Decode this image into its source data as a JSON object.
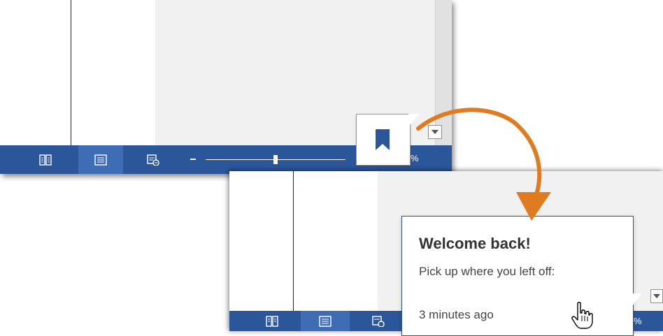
{
  "top_statusbar": {
    "view_buttons": [
      {
        "name": "read-mode",
        "icon": "read-mode-icon"
      },
      {
        "name": "print-layout",
        "icon": "print-layout-icon"
      },
      {
        "name": "web-layout",
        "icon": "web-layout-icon"
      }
    ],
    "zoom_suffix": "%"
  },
  "bottom_statusbar": {
    "zoom_suffix": "%"
  },
  "welcome_popup": {
    "title": "Welcome back!",
    "subtitle": "Pick up where you left off:",
    "time": "3 minutes ago"
  },
  "icons": {
    "bookmark": "bookmark-icon",
    "dropdown": "chevron-down-icon",
    "cursor": "hand-pointer-icon"
  },
  "colors": {
    "statusbar": "#2b579a",
    "active_button": "#3e6db5",
    "arrow": "#e07b20",
    "bookmark": "#2b579a"
  }
}
